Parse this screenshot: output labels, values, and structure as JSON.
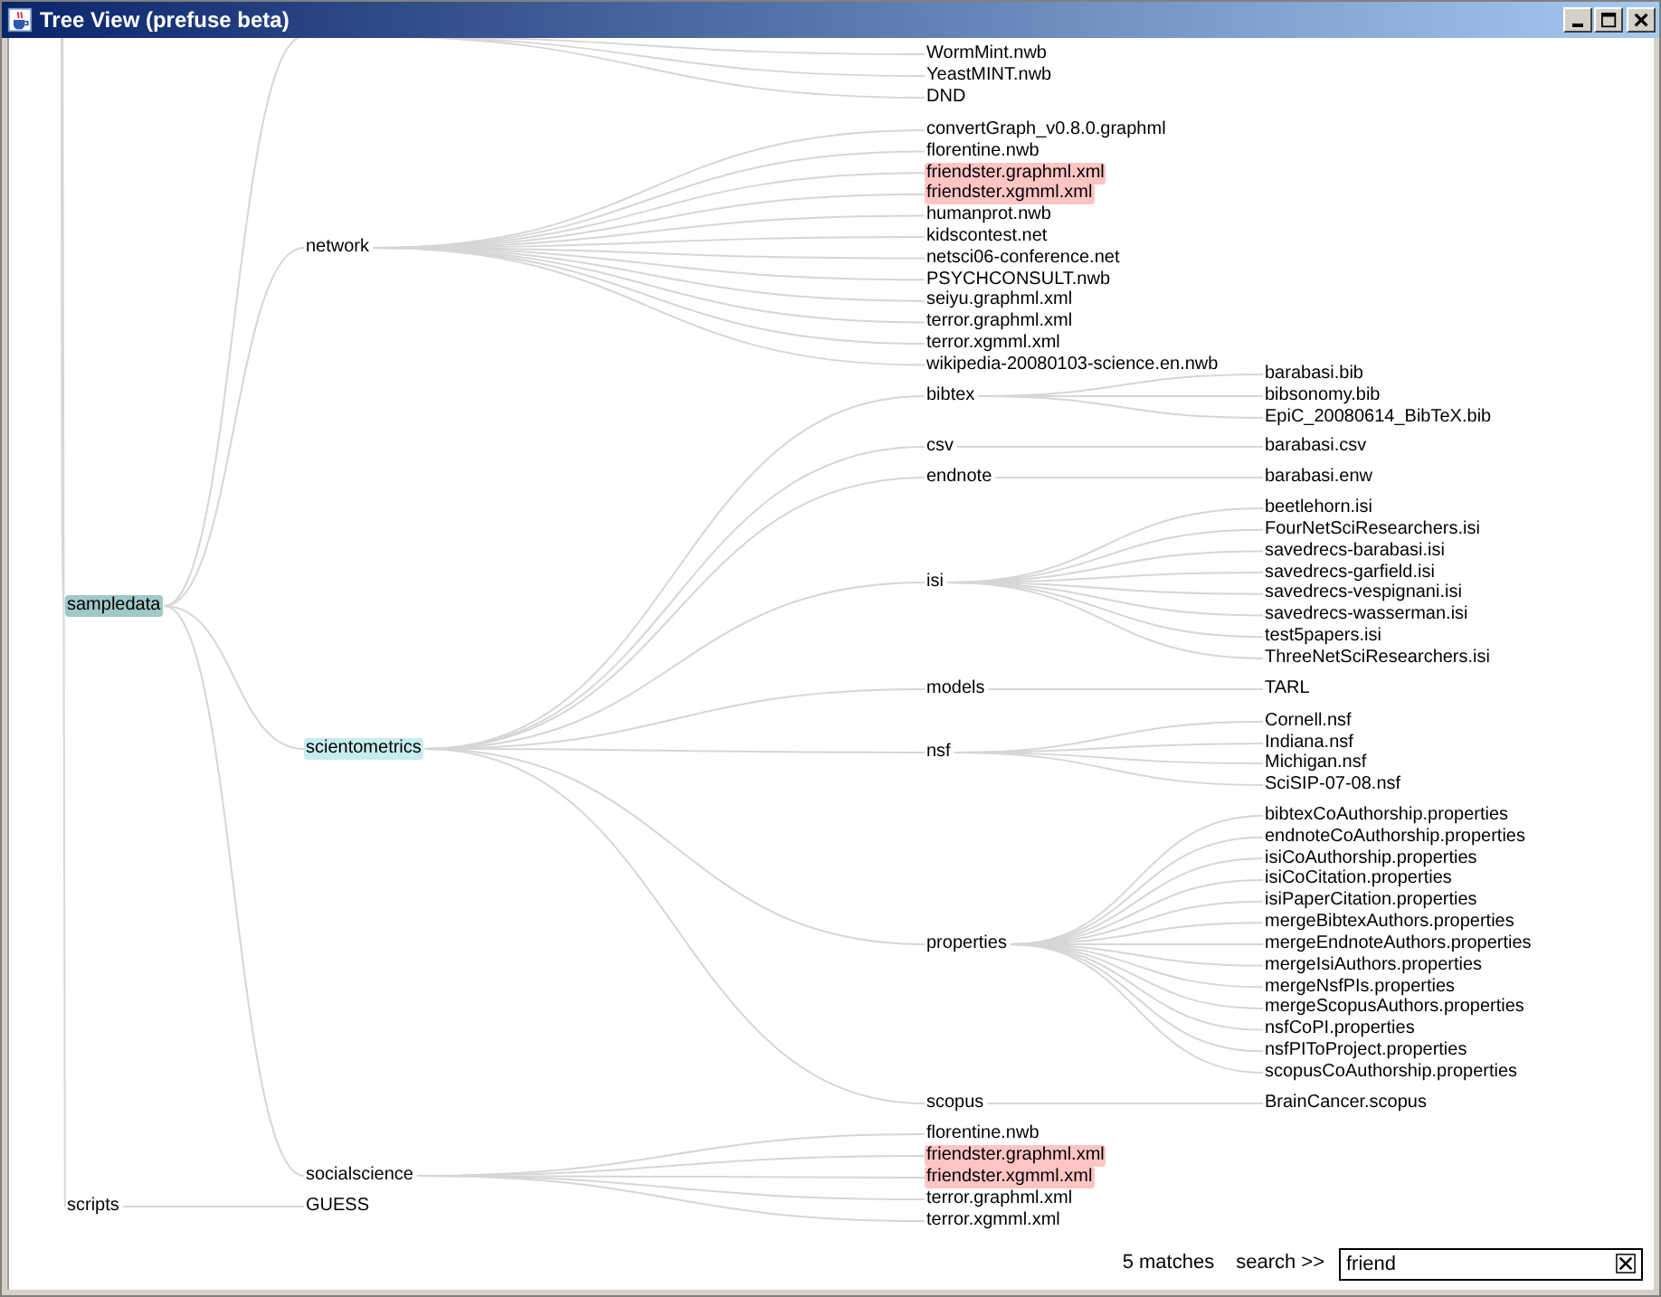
{
  "window": {
    "title": "Tree View (prefuse beta)"
  },
  "tree": {
    "children": [
      {
        "label": "sampledata",
        "focus": true,
        "children": [
          {
            "children": [
              {
                "label": "WormMint.nwb"
              },
              {
                "label": "YeastMINT.nwb"
              },
              {
                "label": "DND"
              }
            ]
          },
          {
            "label": "network",
            "children": [
              {
                "label": "convertGraph_v0.8.0.graphml"
              },
              {
                "label": "florentine.nwb"
              },
              {
                "label": "friendster.graphml.xml",
                "match": true
              },
              {
                "label": "friendster.xgmml.xml",
                "match": true
              },
              {
                "label": "humanprot.nwb"
              },
              {
                "label": "kidscontest.net"
              },
              {
                "label": "netsci06-conference.net"
              },
              {
                "label": "PSYCHCONSULT.nwb"
              },
              {
                "label": "seiyu.graphml.xml"
              },
              {
                "label": "terror.graphml.xml"
              },
              {
                "label": "terror.xgmml.xml"
              },
              {
                "label": "wikipedia-20080103-science.en.nwb"
              }
            ]
          },
          {
            "label": "scientometrics",
            "on_path": true,
            "children": [
              {
                "label": "bibtex",
                "children": [
                  {
                    "label": "barabasi.bib"
                  },
                  {
                    "label": "bibsonomy.bib"
                  },
                  {
                    "label": "EpiC_20080614_BibTeX.bib"
                  }
                ]
              },
              {
                "label": "csv",
                "children": [
                  {
                    "label": "barabasi.csv"
                  }
                ]
              },
              {
                "label": "endnote",
                "children": [
                  {
                    "label": "barabasi.enw"
                  }
                ]
              },
              {
                "label": "isi",
                "children": [
                  {
                    "label": "beetlehorn.isi"
                  },
                  {
                    "label": "FourNetSciResearchers.isi"
                  },
                  {
                    "label": "savedrecs-barabasi.isi"
                  },
                  {
                    "label": "savedrecs-garfield.isi"
                  },
                  {
                    "label": "savedrecs-vespignani.isi"
                  },
                  {
                    "label": "savedrecs-wasserman.isi"
                  },
                  {
                    "label": "test5papers.isi"
                  },
                  {
                    "label": "ThreeNetSciResearchers.isi"
                  }
                ]
              },
              {
                "label": "models",
                "children": [
                  {
                    "label": "TARL"
                  }
                ]
              },
              {
                "label": "nsf",
                "children": [
                  {
                    "label": "Cornell.nsf"
                  },
                  {
                    "label": "Indiana.nsf"
                  },
                  {
                    "label": "Michigan.nsf"
                  },
                  {
                    "label": "SciSIP-07-08.nsf"
                  }
                ]
              },
              {
                "label": "properties",
                "children": [
                  {
                    "label": "bibtexCoAuthorship.properties"
                  },
                  {
                    "label": "endnoteCoAuthorship.properties"
                  },
                  {
                    "label": "isiCoAuthorship.properties"
                  },
                  {
                    "label": "isiCoCitation.properties"
                  },
                  {
                    "label": "isiPaperCitation.properties"
                  },
                  {
                    "label": "mergeBibtexAuthors.properties"
                  },
                  {
                    "label": "mergeEndnoteAuthors.properties"
                  },
                  {
                    "label": "mergeIsiAuthors.properties"
                  },
                  {
                    "label": "mergeNsfPIs.properties"
                  },
                  {
                    "label": "mergeScopusAuthors.properties"
                  },
                  {
                    "label": "nsfCoPI.properties"
                  },
                  {
                    "label": "nsfPIToProject.properties"
                  },
                  {
                    "label": "scopusCoAuthorship.properties"
                  }
                ]
              },
              {
                "label": "scopus",
                "children": [
                  {
                    "label": "BrainCancer.scopus"
                  }
                ]
              }
            ]
          },
          {
            "label": "socialscience",
            "children": [
              {
                "label": "florentine.nwb"
              },
              {
                "label": "friendster.graphml.xml",
                "match": true
              },
              {
                "label": "friendster.xgmml.xml",
                "match": true
              },
              {
                "label": "terror.graphml.xml"
              },
              {
                "label": "terror.xgmml.xml"
              }
            ]
          }
        ]
      },
      {
        "label": "scripts",
        "children": [
          {
            "label": "GUESS"
          }
        ]
      }
    ]
  },
  "search": {
    "status": "5 matches",
    "label": "search >>",
    "value": "friend"
  }
}
